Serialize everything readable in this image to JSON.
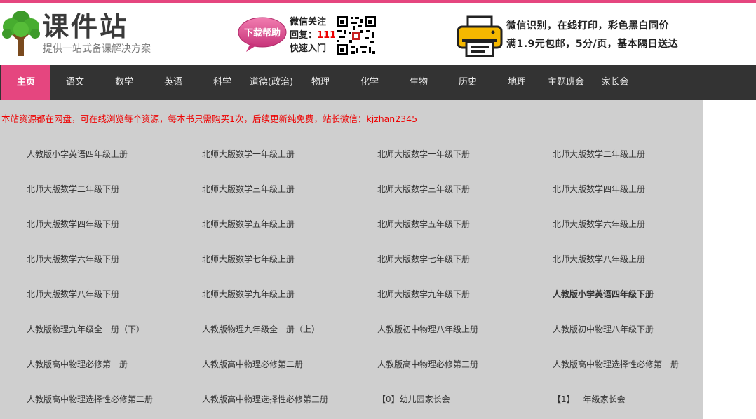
{
  "header": {
    "logo_title": "课件站",
    "logo_subtitle": "提供一站式备课解决方案",
    "help_badge": "下载帮助",
    "wechat_lines": [
      "微信关注",
      "回复：",
      "快速入门"
    ],
    "wechat_code": "111",
    "print_lines": [
      "微信识别，在线打印，彩色黑白同价",
      "满1.9元包邮，5分/页，基本隔日送达"
    ]
  },
  "nav": {
    "items": [
      "主页",
      "语文",
      "数学",
      "英语",
      "科学",
      "道德(政治)",
      "物理",
      "化学",
      "生物",
      "历史",
      "地理",
      "主题班会",
      "家长会"
    ],
    "active": "主页"
  },
  "notice": "本站资源都在网盘，可在线浏览每个资源，每本书只需购买1次，后续更新纯免费，站长微信：kjzhan2345",
  "books": [
    "人教版小学英语四年级上册",
    "北师大版数学一年级上册",
    "北师大版数学一年级下册",
    "北师大版数学二年级上册",
    "北师大版数学二年级下册",
    "北师大版数学三年级上册",
    "北师大版数学三年级下册",
    "北师大版数学四年级上册",
    "北师大版数学四年级下册",
    "北师大版数学五年级上册",
    "北师大版数学五年级下册",
    "北师大版数学六年级上册",
    "北师大版数学六年级下册",
    "北师大版数学七年级上册",
    "北师大版数学七年级下册",
    "北师大版数学八年级上册",
    "北师大版数学八年级下册",
    "北师大版数学九年级上册",
    "北师大版数学九年级下册",
    "人教版小学英语四年级下册",
    "人教版物理九年级全一册（下）",
    "人教版物理九年级全一册（上）",
    "人教版初中物理八年级上册",
    "人教版初中物理八年级下册",
    "人教版高中物理必修第一册",
    "人教版高中物理必修第二册",
    "人教版高中物理必修第三册",
    "人教版高中物理选择性必修第一册",
    "人教版高中物理选择性必修第二册",
    "人教版高中物理选择性必修第三册",
    "【0】幼儿园家长会",
    "【1】一年级家长会"
  ],
  "bold_book": "人教版小学英语四年级下册"
}
